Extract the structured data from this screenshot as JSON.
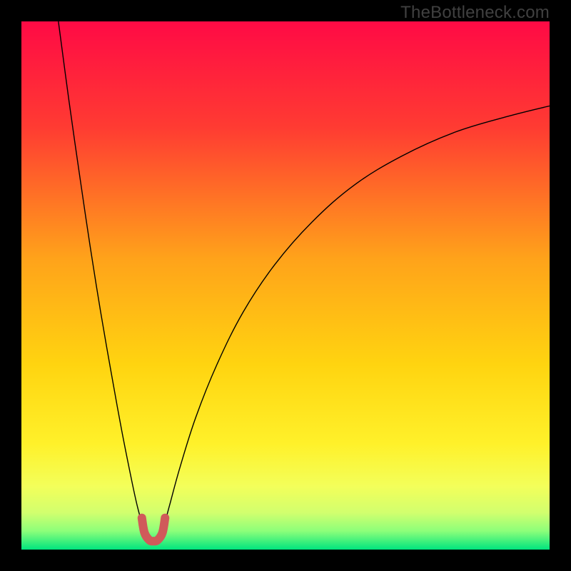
{
  "watermark": "TheBottleneck.com",
  "chart_data": {
    "type": "line",
    "title": "",
    "xlabel": "",
    "ylabel": "",
    "xlim": [
      0,
      100
    ],
    "ylim": [
      0,
      100
    ],
    "grid": false,
    "legend": false,
    "background_gradient": {
      "stops": [
        {
          "offset": 0.0,
          "color": "#ff0a45"
        },
        {
          "offset": 0.2,
          "color": "#ff3b32"
        },
        {
          "offset": 0.45,
          "color": "#ffa31a"
        },
        {
          "offset": 0.65,
          "color": "#ffd410"
        },
        {
          "offset": 0.8,
          "color": "#fff12a"
        },
        {
          "offset": 0.88,
          "color": "#f3ff5a"
        },
        {
          "offset": 0.93,
          "color": "#d2ff6e"
        },
        {
          "offset": 0.965,
          "color": "#8cff7a"
        },
        {
          "offset": 1.0,
          "color": "#00e57e"
        }
      ]
    },
    "series": [
      {
        "name": "bottleneck-curve",
        "stroke": "#000000",
        "stroke_width": 1.4,
        "points": [
          {
            "x": 7.0,
            "y": 100.0
          },
          {
            "x": 9.0,
            "y": 85.0
          },
          {
            "x": 11.0,
            "y": 71.0
          },
          {
            "x": 13.0,
            "y": 57.5
          },
          {
            "x": 15.0,
            "y": 45.0
          },
          {
            "x": 17.0,
            "y": 33.5
          },
          {
            "x": 19.0,
            "y": 22.5
          },
          {
            "x": 21.0,
            "y": 12.5
          },
          {
            "x": 22.0,
            "y": 8.0
          },
          {
            "x": 23.0,
            "y": 4.5
          },
          {
            "x": 24.0,
            "y": 2.4
          },
          {
            "x": 25.0,
            "y": 2.0
          },
          {
            "x": 26.0,
            "y": 2.4
          },
          {
            "x": 27.0,
            "y": 4.6
          },
          {
            "x": 28.0,
            "y": 8.2
          },
          {
            "x": 30.0,
            "y": 15.5
          },
          {
            "x": 33.0,
            "y": 25.0
          },
          {
            "x": 37.0,
            "y": 35.0
          },
          {
            "x": 42.0,
            "y": 45.0
          },
          {
            "x": 48.0,
            "y": 54.0
          },
          {
            "x": 55.0,
            "y": 62.0
          },
          {
            "x": 63.0,
            "y": 69.0
          },
          {
            "x": 72.0,
            "y": 74.5
          },
          {
            "x": 82.0,
            "y": 79.0
          },
          {
            "x": 92.0,
            "y": 82.0
          },
          {
            "x": 100.0,
            "y": 84.0
          }
        ]
      },
      {
        "name": "optimal-marker",
        "stroke": "#d05a5a",
        "stroke_width": 12,
        "linecap": "round",
        "points": [
          {
            "x": 22.8,
            "y": 6.0
          },
          {
            "x": 23.3,
            "y": 3.2
          },
          {
            "x": 24.2,
            "y": 1.8
          },
          {
            "x": 25.0,
            "y": 1.6
          },
          {
            "x": 25.8,
            "y": 1.8
          },
          {
            "x": 26.7,
            "y": 3.2
          },
          {
            "x": 27.2,
            "y": 6.0
          }
        ]
      }
    ]
  }
}
